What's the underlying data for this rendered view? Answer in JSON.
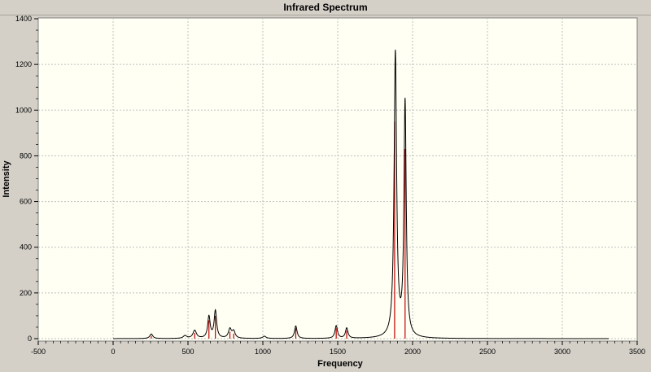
{
  "chart_data": {
    "type": "line",
    "title": "Infrared Spectrum",
    "xlabel": "Frequency",
    "ylabel": "Intensity",
    "xlim": [
      -500,
      3500
    ],
    "ylim": [
      0,
      1400
    ],
    "x_ticks": [
      -500,
      0,
      500,
      1000,
      1500,
      2000,
      2500,
      3000,
      3500
    ],
    "y_ticks": [
      0,
      200,
      400,
      600,
      800,
      1000,
      1200,
      1400
    ],
    "grid": true,
    "colors": {
      "spectrum": "#000000",
      "sticks": "#c00000",
      "grid": "#c0c0c0",
      "plot_bg": "#fffff4",
      "frame_bg": "#d4d0c8"
    },
    "series": [
      {
        "type": "line",
        "spectrum_range": [
          0,
          3310
        ],
        "peaks": [
          {
            "x": 255,
            "y": 20,
            "width": 12
          },
          {
            "x": 480,
            "y": 12,
            "width": 14
          },
          {
            "x": 545,
            "y": 35,
            "width": 14
          },
          {
            "x": 640,
            "y": 95,
            "width": 10
          },
          {
            "x": 683,
            "y": 120,
            "width": 10
          },
          {
            "x": 780,
            "y": 40,
            "width": 12
          },
          {
            "x": 805,
            "y": 30,
            "width": 12
          },
          {
            "x": 1010,
            "y": 10,
            "width": 14
          },
          {
            "x": 1220,
            "y": 55,
            "width": 10
          },
          {
            "x": 1490,
            "y": 55,
            "width": 10
          },
          {
            "x": 1560,
            "y": 45,
            "width": 10
          },
          {
            "x": 1885,
            "y": 1245,
            "width": 10
          },
          {
            "x": 1950,
            "y": 1025,
            "width": 9
          }
        ]
      },
      {
        "type": "stick",
        "sticks": [
          {
            "x": 255,
            "y": 12
          },
          {
            "x": 545,
            "y": 25
          },
          {
            "x": 640,
            "y": 80
          },
          {
            "x": 683,
            "y": 100
          },
          {
            "x": 780,
            "y": 30
          },
          {
            "x": 805,
            "y": 22
          },
          {
            "x": 1220,
            "y": 45
          },
          {
            "x": 1490,
            "y": 45
          },
          {
            "x": 1560,
            "y": 35
          },
          {
            "x": 1880,
            "y": 950
          },
          {
            "x": 1950,
            "y": 830
          }
        ]
      }
    ]
  }
}
